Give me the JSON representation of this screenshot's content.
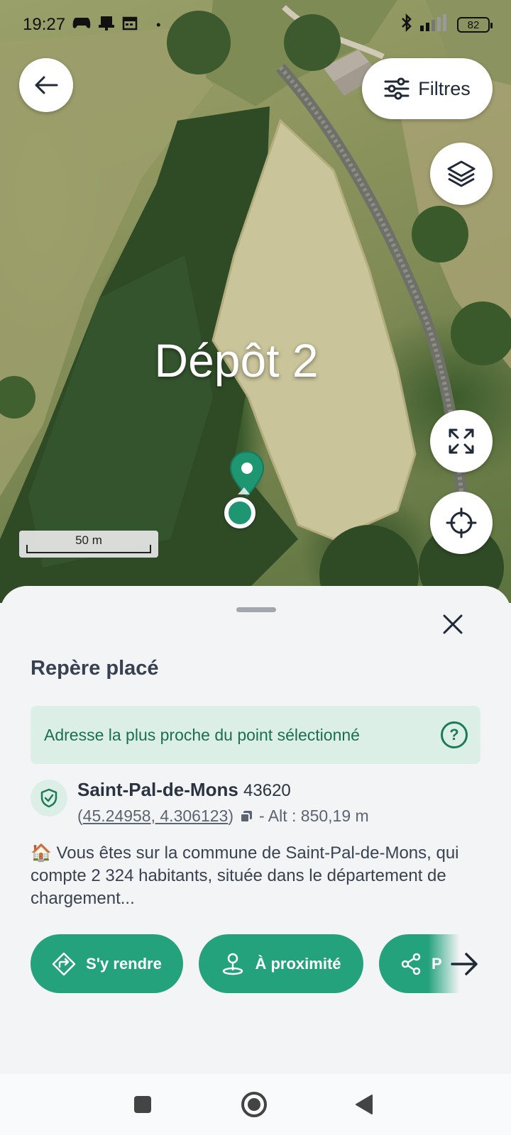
{
  "status_bar": {
    "time": "19:27",
    "battery": "82"
  },
  "map": {
    "title": "Dépôt 2",
    "filters_label": "Filtres",
    "scale_label": "50 m",
    "accent": "#1f9672"
  },
  "sheet": {
    "title": "Repère placé",
    "nearest_label": "Adresse la plus proche du point sélectionné",
    "help_symbol": "?",
    "place_name": "Saint-Pal-de-Mons",
    "postcode": "43620",
    "coords": "45.24958, 4.306123",
    "coords_open": "(",
    "coords_close": ")",
    "altitude": "- Alt : 850,19 m",
    "description": "🏠 Vous êtes sur la commune de Saint-Pal-de-Mons, qui compte 2 324 habitants, située dans le département de chargement...",
    "actions": [
      {
        "label": "S'y rendre",
        "icon": "directions-icon"
      },
      {
        "label": "À proximité",
        "icon": "nearby-pin-icon"
      },
      {
        "label": "P",
        "icon": "share-icon"
      }
    ]
  }
}
